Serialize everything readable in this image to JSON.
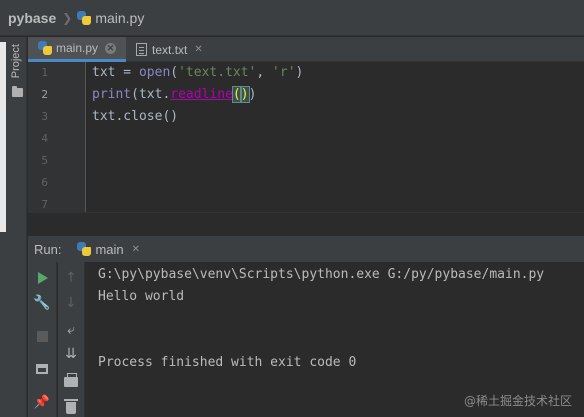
{
  "breadcrumb": {
    "project": "pybase",
    "file": "main.py"
  },
  "left_stripe": {
    "project_label": "Project"
  },
  "tabs": [
    {
      "label": "main.py",
      "active": true,
      "close": "✕"
    },
    {
      "label": "text.txt",
      "active": false,
      "close": "✕"
    }
  ],
  "editor": {
    "line_numbers": [
      "1",
      "2",
      "3",
      "4",
      "5",
      "6",
      "7"
    ],
    "current_line": 2,
    "lines": [
      {
        "parts": [
          "txt = ",
          "open",
          "(",
          "'text.txt'",
          ", ",
          "'r'",
          ")"
        ]
      },
      {
        "parts": [
          "print",
          "(txt.",
          "readline",
          "(",
          ")",
          ")"
        ]
      },
      {
        "parts": [
          "txt.close()"
        ]
      }
    ]
  },
  "run": {
    "label": "Run:",
    "tab": {
      "label": "main",
      "close": "✕"
    },
    "output": [
      "G:\\py\\pybase\\venv\\Scripts\\python.exe G:/py/pybase/main.py",
      "Hello world",
      "",
      "",
      "Process finished with exit code 0"
    ]
  },
  "icons": {
    "run": "play-icon",
    "settings": "wrench-icon",
    "stop": "stop-icon",
    "layout": "layout-icon",
    "pin": "pin-icon",
    "up": "arrow-up-icon",
    "down": "arrow-down-icon",
    "soft_wrap": "soft-wrap-icon",
    "scroll_end": "scroll-to-end-icon",
    "print": "print-icon",
    "clear": "trash-icon"
  },
  "watermark": "@稀土掘金技术社区",
  "colors": {
    "background": "#2b2b2b",
    "panel": "#3c3f41",
    "keyword_builtin": "#8888c6",
    "string": "#6a8759",
    "method": "#b200b2",
    "run_green": "#59a869",
    "tab_accent": "#4a88c7"
  }
}
